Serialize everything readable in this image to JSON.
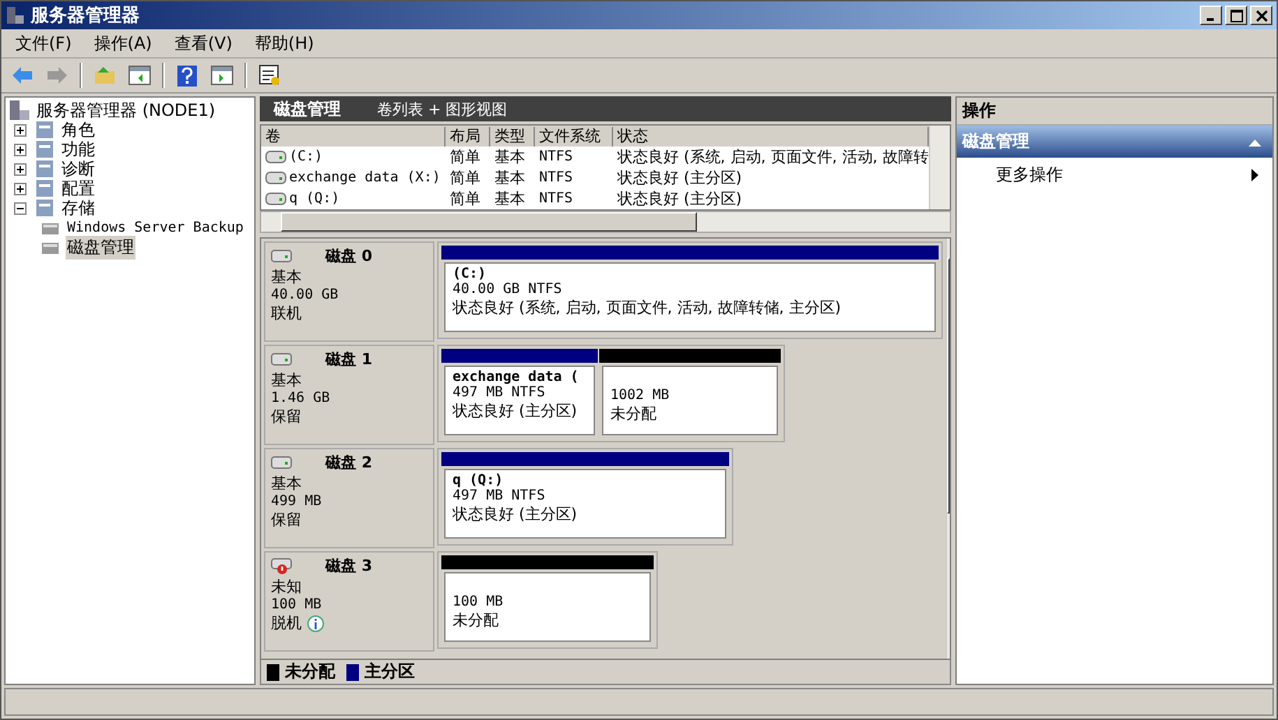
{
  "window": {
    "title": "服务器管理器"
  },
  "menu": [
    "文件(F)",
    "操作(A)",
    "查看(V)",
    "帮助(H)"
  ],
  "tree": {
    "label": "服务器管理器 (NODE1)",
    "selected": false,
    "children": [
      {
        "label": "角色",
        "expanded": false,
        "selected": false
      },
      {
        "label": "功能",
        "expanded": false,
        "selected": false
      },
      {
        "label": "诊断",
        "expanded": false,
        "selected": false
      },
      {
        "label": "配置",
        "expanded": false,
        "selected": false
      },
      {
        "label": "存储",
        "expanded": true,
        "selected": false,
        "children": [
          {
            "label": "Windows Server Backup",
            "selected": false
          },
          {
            "label": "磁盘管理",
            "selected": true
          }
        ]
      }
    ]
  },
  "center": {
    "title": "磁盘管理",
    "subtitle": "卷列表 + 图形视图"
  },
  "volume_table": {
    "columns": [
      "卷",
      "布局",
      "类型",
      "文件系统",
      "状态"
    ],
    "rows": [
      [
        "(C:)",
        "简单",
        "基本",
        "NTFS",
        "状态良好 (系统, 启动, 页面文件, 活动, 故障转"
      ],
      [
        "exchange data (X:)",
        "简单",
        "基本",
        "NTFS",
        "状态良好 (主分区)"
      ],
      [
        "q (Q:)",
        "简单",
        "基本",
        "NTFS",
        "状态良好 (主分区)"
      ]
    ]
  },
  "disks": [
    {
      "name": "磁盘 0",
      "kind": "normal",
      "type": "基本",
      "size": "40.00 GB",
      "status": "联机",
      "info": false,
      "partitions": [
        {
          "kind": "primary",
          "title": "(C:)",
          "size": "40.00 GB NTFS",
          "status": "状态良好 (系统, 启动, 页面文件, 活动, 故障转储, 主分区)"
        }
      ]
    },
    {
      "name": "磁盘 1",
      "kind": "normal",
      "type": "基本",
      "size": "1.46 GB",
      "status": "保留",
      "info": false,
      "partitions": [
        {
          "kind": "primary",
          "title": "exchange data (",
          "size": "497 MB NTFS",
          "status": "状态良好 (主分区)"
        },
        {
          "kind": "unallocated",
          "size": "1002 MB",
          "status": "未分配"
        }
      ]
    },
    {
      "name": "磁盘 2",
      "kind": "normal",
      "type": "基本",
      "size": "499 MB",
      "status": "保留",
      "info": false,
      "partitions": [
        {
          "kind": "primary",
          "title": "q (Q:)",
          "size": "497 MB NTFS",
          "status": "状态良好 (主分区)"
        }
      ]
    },
    {
      "name": "磁盘 3",
      "kind": "error",
      "type": "未知",
      "size": "100 MB",
      "status": "脱机",
      "info": true,
      "partitions": [
        {
          "kind": "unallocated",
          "size": "100 MB",
          "status": "未分配"
        }
      ]
    }
  ],
  "legend": [
    {
      "label": "未分配",
      "color": "#000000"
    },
    {
      "label": "主分区",
      "color": "#000080"
    }
  ],
  "actions": {
    "title": "操作",
    "sections": [
      {
        "title": "磁盘管理",
        "expanded": true,
        "items": [
          "更多操作"
        ]
      }
    ]
  }
}
